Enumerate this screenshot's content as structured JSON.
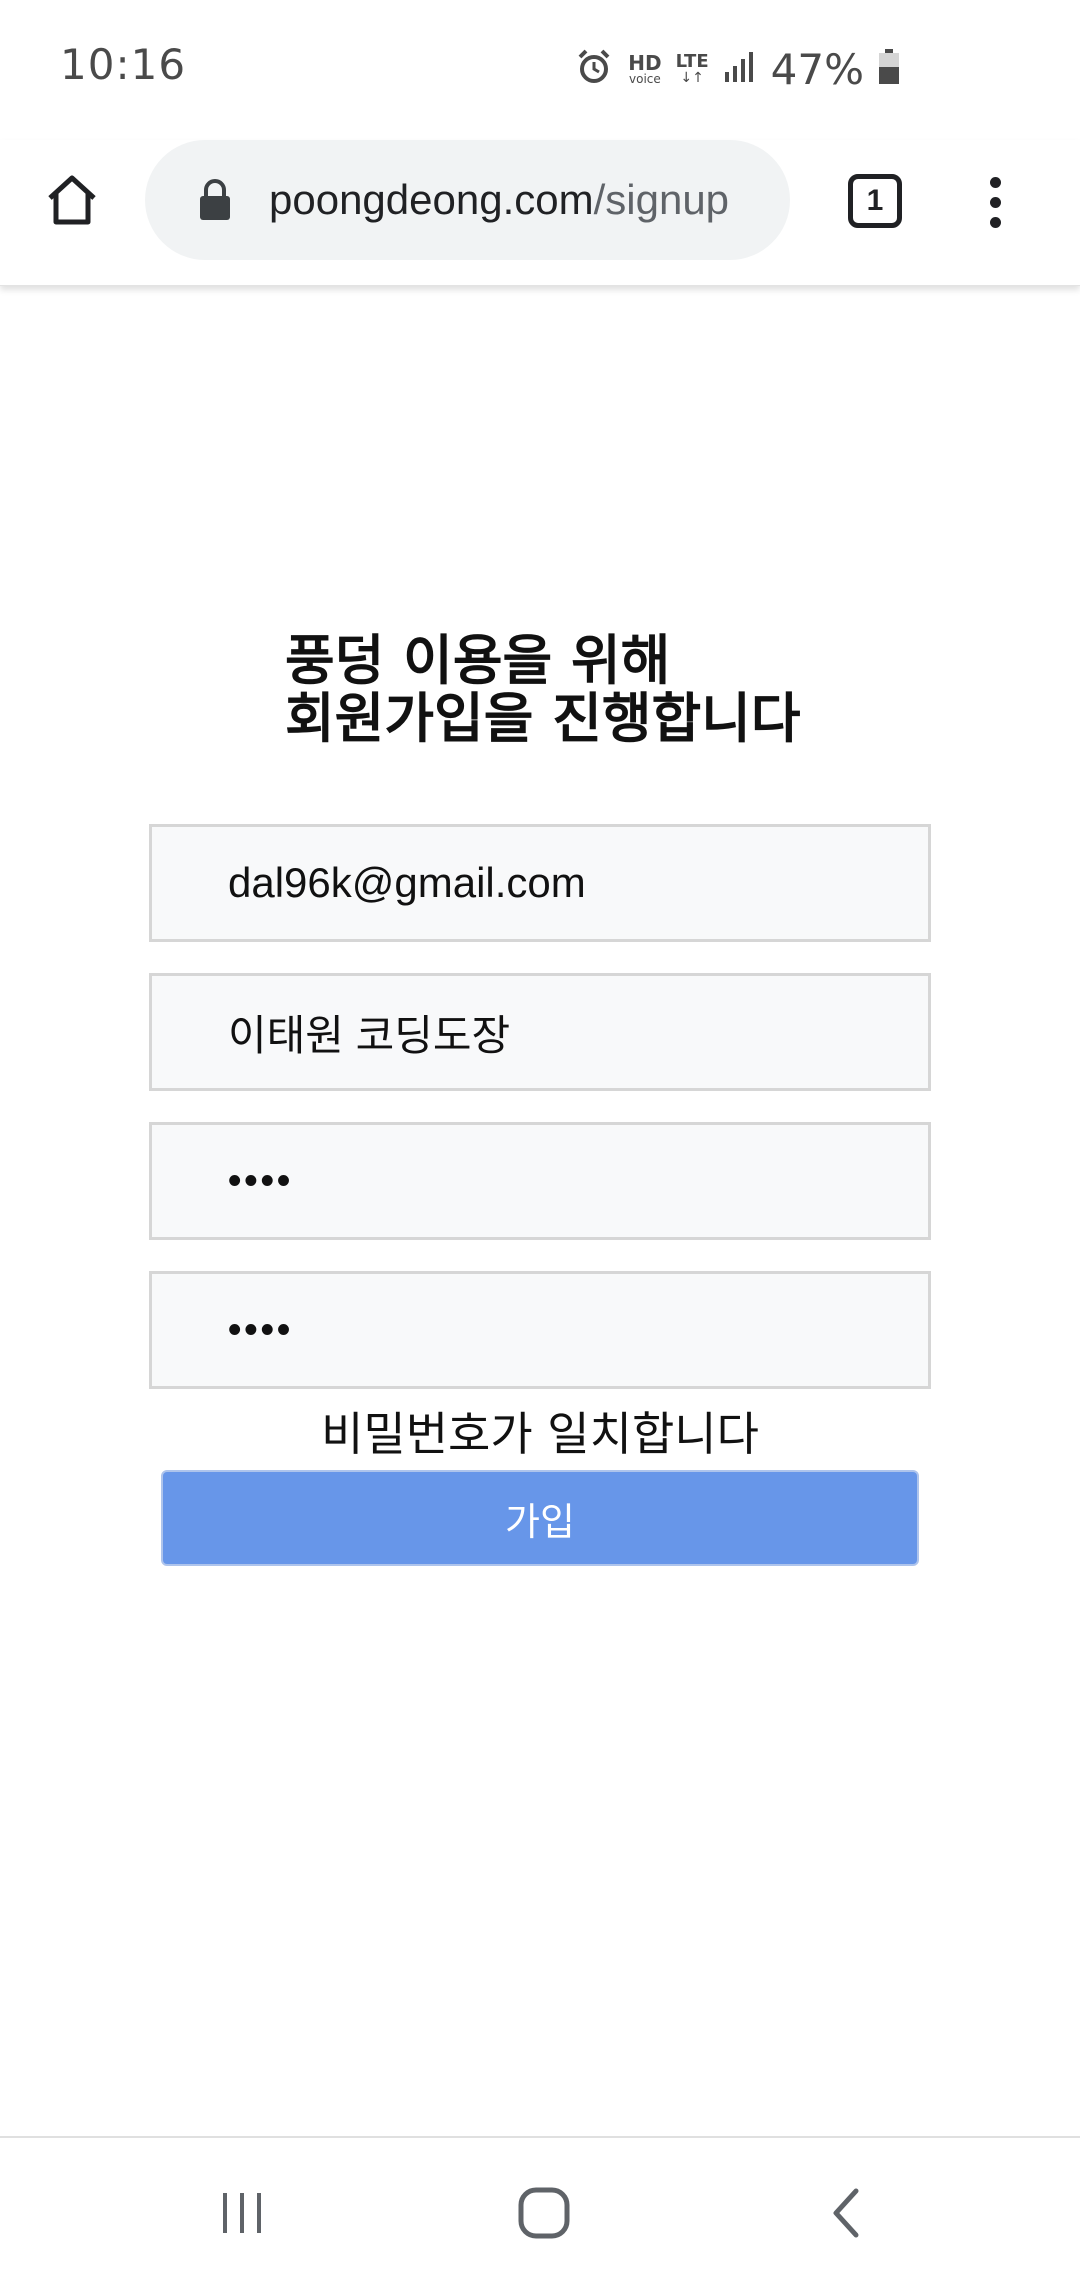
{
  "status_bar": {
    "time": "10:16",
    "hd_label": "HD",
    "voice_label": "voice",
    "lte_label": "LTE",
    "battery_percent": "47%",
    "icons": [
      "alarm-icon",
      "hd-voice-icon",
      "lte-icon",
      "signal-icon",
      "battery-icon"
    ]
  },
  "browser": {
    "url_domain": "poongdeong.com",
    "url_path": "/signup",
    "tab_count": "1",
    "icons": [
      "home-icon",
      "lock-icon",
      "tab-switcher-icon",
      "more-vert-icon"
    ]
  },
  "signup": {
    "heading_line1": "풍덩 이용을 위해",
    "heading_line2": "회원가입을 진행합니다",
    "email_value": "dal96k@gmail.com",
    "name_value": "이태원 코딩도장",
    "password_value": "••••",
    "password_confirm_value": "••••",
    "match_message": "비밀번호가 일치합니다",
    "submit_label": "가입",
    "button_color": "#6796e9"
  },
  "nav_bar": {
    "icons": [
      "recents-icon",
      "home-circle-icon",
      "back-icon"
    ]
  }
}
